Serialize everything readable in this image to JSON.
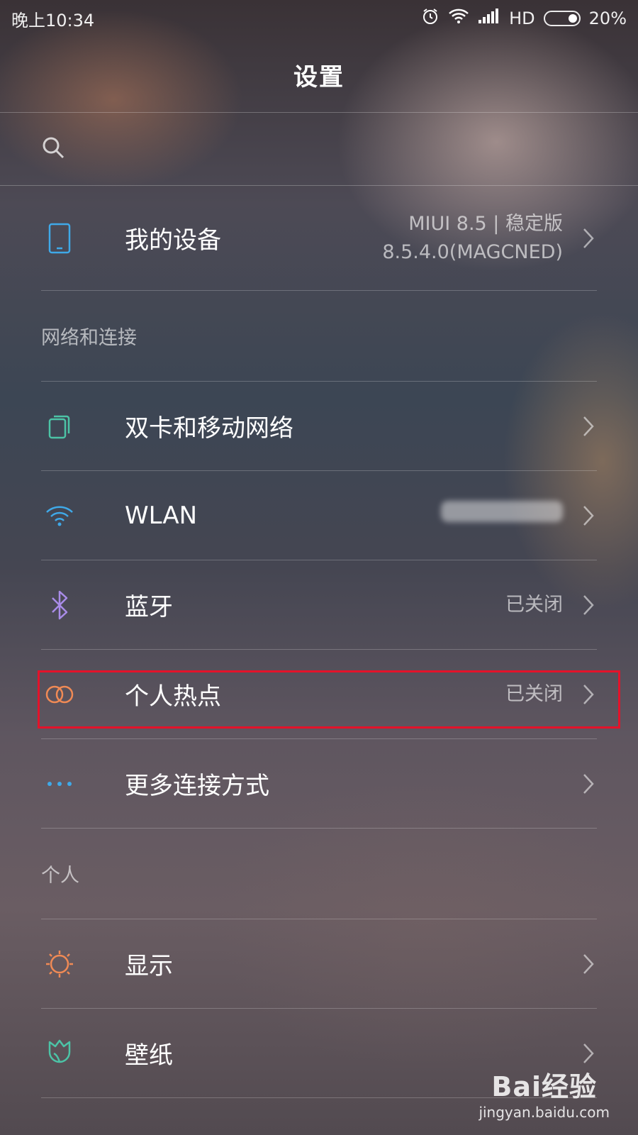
{
  "status_bar": {
    "time": "晚上10:34",
    "network_label": "HD",
    "battery_percent": "20%",
    "icons": [
      "alarm-icon",
      "wifi-icon",
      "signal-icon",
      "battery-icon"
    ]
  },
  "header": {
    "title": "设置"
  },
  "search": {
    "icon": "search-icon"
  },
  "my_device": {
    "label": "我的设备",
    "value_line1": "MIUI 8.5 | 稳定版",
    "value_line2": "8.5.4.0(MAGCNED)",
    "icon": "phone-icon",
    "icon_color": "#3fa9e8"
  },
  "sections": {
    "network": {
      "header": "网络和连接",
      "items": [
        {
          "label": "双卡和移动网络",
          "value": "",
          "icon": "sim-cards-icon",
          "icon_color": "#4cc3a6"
        },
        {
          "label": "WLAN",
          "value": "",
          "icon": "wifi-icon",
          "icon_color": "#3fa9e8"
        },
        {
          "label": "蓝牙",
          "value": "已关闭",
          "icon": "bluetooth-icon",
          "icon_color": "#a98ce8"
        },
        {
          "label": "个人热点",
          "value": "已关闭",
          "icon": "hotspot-icon",
          "icon_color": "#f08a55",
          "highlighted": true
        },
        {
          "label": "更多连接方式",
          "value": "",
          "icon": "more-dots-icon",
          "icon_color": "#3fa9e8"
        }
      ]
    },
    "personal": {
      "header": "个人",
      "items": [
        {
          "label": "显示",
          "value": "",
          "icon": "brightness-icon",
          "icon_color": "#f08a55"
        },
        {
          "label": "壁纸",
          "value": "",
          "icon": "wallpaper-tulip-icon",
          "icon_color": "#4cc3a6"
        }
      ]
    }
  },
  "highlight_color": "#e4122a",
  "watermark": {
    "main": "Bai经验",
    "sub": "jingyan.baidu.com"
  }
}
